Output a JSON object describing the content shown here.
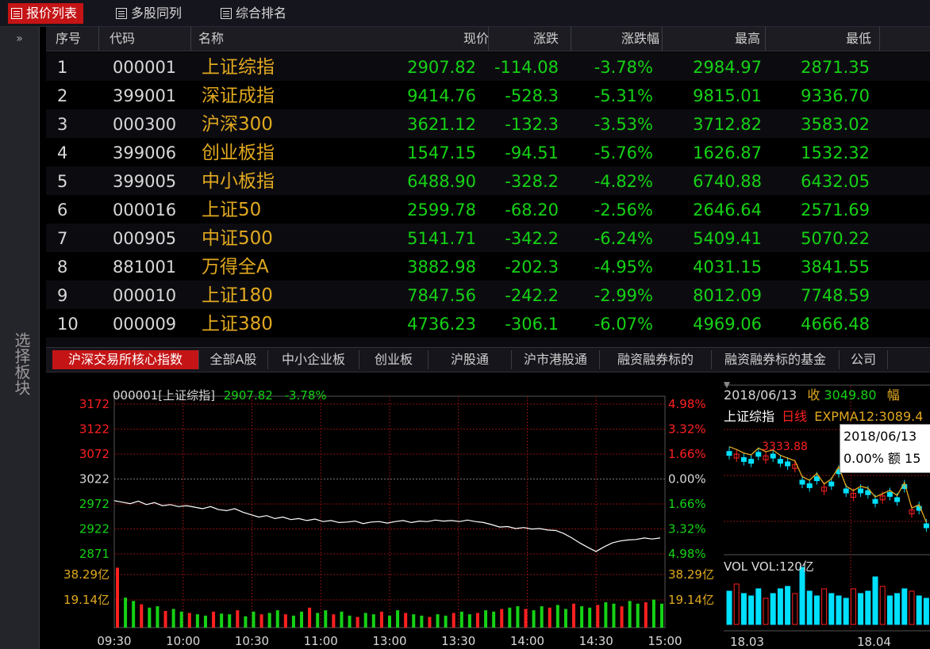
{
  "top_tabs": [
    {
      "label": "报价列表",
      "icon": "grid-icon",
      "active": true
    },
    {
      "label": "多股同列",
      "icon": "multi-chart-icon",
      "active": false
    },
    {
      "label": "综合排名",
      "icon": "bar-chart-icon",
      "active": false
    }
  ],
  "sidebar": {
    "collapse_glyph": "»",
    "sector_label": "选择板块"
  },
  "table": {
    "headers": [
      "序号",
      "代码",
      "名称",
      "现价",
      "涨跌",
      "涨跌幅",
      "最高",
      "最低"
    ],
    "rows": [
      {
        "no": "1",
        "code": "000001",
        "name": "上证综指",
        "price": "2907.82",
        "chg": "-114.08",
        "pct": "-3.78%",
        "high": "2984.97",
        "low": "2871.35"
      },
      {
        "no": "2",
        "code": "399001",
        "name": "深证成指",
        "price": "9414.76",
        "chg": "-528.3",
        "pct": "-5.31%",
        "high": "9815.01",
        "low": "9336.70"
      },
      {
        "no": "3",
        "code": "000300",
        "name": "沪深300",
        "price": "3621.12",
        "chg": "-132.3",
        "pct": "-3.53%",
        "high": "3712.82",
        "low": "3583.02"
      },
      {
        "no": "4",
        "code": "399006",
        "name": "创业板指",
        "price": "1547.15",
        "chg": "-94.51",
        "pct": "-5.76%",
        "high": "1626.87",
        "low": "1532.32"
      },
      {
        "no": "5",
        "code": "399005",
        "name": "中小板指",
        "price": "6488.90",
        "chg": "-328.2",
        "pct": "-4.82%",
        "high": "6740.88",
        "low": "6432.05"
      },
      {
        "no": "6",
        "code": "000016",
        "name": "上证50",
        "price": "2599.78",
        "chg": "-68.20",
        "pct": "-2.56%",
        "high": "2646.64",
        "low": "2571.69"
      },
      {
        "no": "7",
        "code": "000905",
        "name": "中证500",
        "price": "5141.71",
        "chg": "-342.2",
        "pct": "-6.24%",
        "high": "5409.41",
        "low": "5070.22"
      },
      {
        "no": "8",
        "code": "881001",
        "name": "万得全A",
        "price": "3882.98",
        "chg": "-202.3",
        "pct": "-4.95%",
        "high": "4031.15",
        "low": "3841.55"
      },
      {
        "no": "9",
        "code": "000010",
        "name": "上证180",
        "price": "7847.56",
        "chg": "-242.2",
        "pct": "-2.99%",
        "high": "8012.09",
        "low": "7748.59"
      },
      {
        "no": "10",
        "code": "000009",
        "name": "上证380",
        "price": "4736.23",
        "chg": "-306.1",
        "pct": "-6.07%",
        "high": "4969.06",
        "low": "4666.48"
      }
    ]
  },
  "bottom_tabs": [
    {
      "label": "沪深交易所核心指数",
      "active": true
    },
    {
      "label": "全部A股",
      "active": false
    },
    {
      "label": "中小企业板",
      "active": false
    },
    {
      "label": "创业板",
      "active": false
    },
    {
      "label": "沪股通",
      "active": false
    },
    {
      "label": "沪市港股通",
      "active": false
    },
    {
      "label": "融资融券标的",
      "active": false
    },
    {
      "label": "融资融券标的基金",
      "active": false
    },
    {
      "label": "公司",
      "active": false
    }
  ],
  "colors": {
    "up": "#ff2020",
    "down": "#15d215",
    "name": "#e1a81f",
    "active_tab": "#c51416",
    "grid": "#8a1010",
    "price_line": "#ffffff",
    "ema_line": "#e1a81f"
  },
  "intraday": {
    "title_code": "000001[上证综指]",
    "price": "2907.82",
    "pct": "-3.78%"
  },
  "kline": {
    "date": "2018/06/13",
    "close_label": "收",
    "close_value": "3049.80",
    "range_label": "幅",
    "name": "上证综指",
    "period": "日线",
    "ema_label": "EXPMA12:3089.4",
    "marker_value": "3333.88",
    "vol_label": "VOL VOL:120亿",
    "tooltip_date": "2018/06/13",
    "tooltip_pct": "0.00%",
    "tooltip_amount_label": "额",
    "tooltip_amount_value": "15"
  },
  "chart_data": [
    {
      "type": "line",
      "title": "000001[上证综指] 2907.82 -3.78%",
      "x_ticks": [
        "09:30",
        "10:00",
        "10:30",
        "11:00",
        "13:00",
        "13:30",
        "14:00",
        "14:30",
        "15:00"
      ],
      "y_left_ticks": [
        "3172",
        "3122",
        "3072",
        "3022",
        "2972",
        "2922",
        "2871"
      ],
      "y_right_ticks": [
        "4.98%",
        "3.32%",
        "1.66%",
        "0.00%",
        "1.66%",
        "3.32%",
        "4.98%"
      ],
      "volume_ticks": [
        "38.29亿",
        "19.14亿"
      ],
      "ylim": [
        2871,
        3172
      ],
      "reference": 3022,
      "series": [
        {
          "values": [
            2978,
            2975,
            2972,
            2977,
            2970,
            2974,
            2968,
            2970,
            2966,
            2968,
            2965,
            2962,
            2966,
            2960,
            2958,
            2962,
            2955,
            2950,
            2945,
            2948,
            2942,
            2945,
            2940,
            2942,
            2938,
            2941,
            2936,
            2938,
            2934,
            2935,
            2937,
            2932,
            2935,
            2936,
            2933,
            2936,
            2938,
            2934,
            2937,
            2936,
            2939,
            2937,
            2938,
            2936,
            2939,
            2936,
            2934,
            2930,
            2925,
            2926,
            2922,
            2924,
            2921,
            2922,
            2919,
            2918,
            2912,
            2903,
            2893,
            2884,
            2876,
            2885,
            2893,
            2897,
            2899,
            2900,
            2903,
            2901,
            2903
          ]
        }
      ],
      "volume": [
        90,
        45,
        40,
        35,
        30,
        32,
        25,
        28,
        24,
        22,
        20,
        18,
        24,
        21,
        20,
        26,
        17,
        24,
        20,
        22,
        26,
        20,
        18,
        24,
        30,
        22,
        26,
        20,
        24,
        18,
        16,
        22,
        20,
        24,
        18,
        26,
        22,
        20,
        18,
        16,
        20,
        18,
        22,
        24,
        20,
        22,
        26,
        24,
        28,
        30,
        32,
        28,
        26,
        32,
        30,
        34,
        28,
        36,
        32,
        30,
        34,
        38,
        36,
        32,
        40,
        36,
        38,
        42,
        36
      ]
    },
    {
      "type": "bar",
      "title": "上证综指 日线",
      "x_ticks": [
        "18.03",
        "18.04"
      ],
      "series": [
        {
          "name": "VOL",
          "values": [
            28,
            34,
            26,
            24,
            30,
            22,
            26,
            30,
            32,
            26,
            48,
            28,
            24,
            30,
            26,
            24,
            22,
            30,
            26,
            28,
            40,
            32,
            24,
            26,
            30,
            28,
            24,
            22
          ]
        }
      ],
      "candles": [
        3133,
        3130,
        3126,
        3124,
        3132,
        3128,
        3130,
        3124,
        3121,
        3118,
        3100,
        3096,
        3104,
        3092,
        3098,
        3112,
        3090,
        3085,
        3090,
        3088,
        3078,
        3082,
        3086,
        3080,
        3095,
        3066,
        3070,
        3050
      ]
    }
  ]
}
